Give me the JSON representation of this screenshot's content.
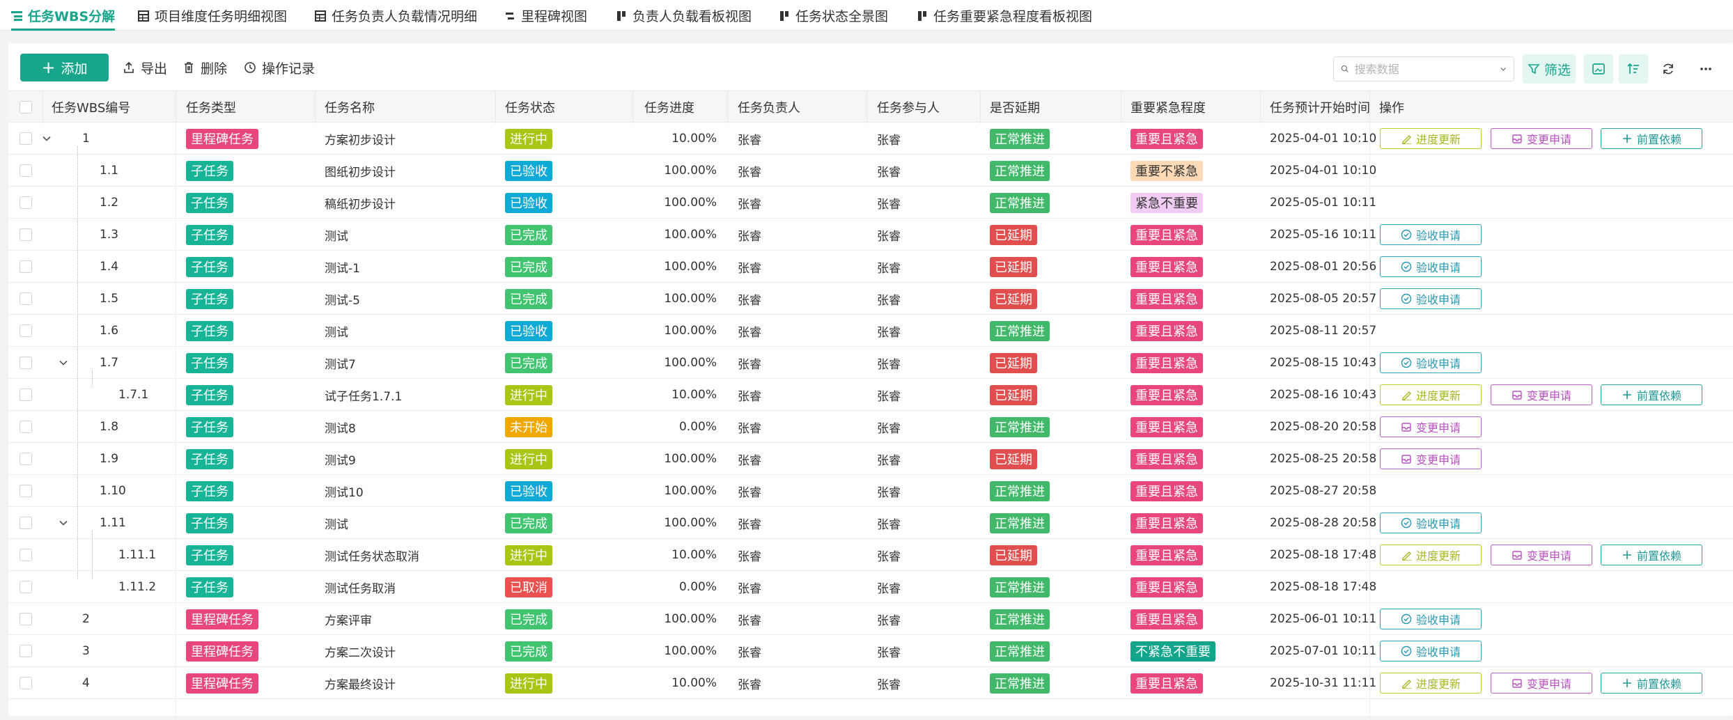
{
  "tabs": [
    {
      "label": "任务WBS分解",
      "icon": "list-icon",
      "active": true
    },
    {
      "label": "项目维度任务明细视图",
      "icon": "table-icon"
    },
    {
      "label": "任务负责人负载情况明细",
      "icon": "table-icon"
    },
    {
      "label": "里程碑视图",
      "icon": "milestone-icon"
    },
    {
      "label": "负责人负载看板视图",
      "icon": "kanban-icon"
    },
    {
      "label": "任务状态全景图",
      "icon": "kanban-icon"
    },
    {
      "label": "任务重要紧急程度看板视图",
      "icon": "kanban-icon"
    }
  ],
  "toolbar": {
    "add_label": "添加",
    "export_label": "导出",
    "delete_label": "删除",
    "history_label": "操作记录",
    "search_placeholder": "搜索数据",
    "filter_label": "筛选"
  },
  "columns": [
    "任务WBS编号",
    "任务类型",
    "任务名称",
    "任务状态",
    "任务进度",
    "任务负责人",
    "任务参与人",
    "是否延期",
    "重要紧急程度",
    "任务预计开始时间",
    "操作"
  ],
  "actions": {
    "progress": "进度更新",
    "change": "变更申请",
    "prereq": "前置依赖",
    "accept": "验收申请"
  },
  "colors": {
    "accent": "#17a58c",
    "milestone": "#e8467c",
    "subtask": "#17b497",
    "in_progress": "#a8c616",
    "accepted": "#11a9d6",
    "done": "#41c470",
    "not_started": "#f0a800",
    "cancelled": "#e9504f",
    "normal": "#41b86a",
    "delayed": "#e14e4e",
    "urgent_important": "#e8467c",
    "important_not_urgent": "#fdd9b5",
    "urgent_not_important": "#f1ccf4",
    "neither": "#12a58b"
  },
  "rows": [
    {
      "wbs": "1",
      "level": 0,
      "expanded": true,
      "type": "里程碑任务",
      "name": "方案初步设计",
      "status": "进行中",
      "progress": "10.00%",
      "owner": "张睿",
      "participant": "张睿",
      "delay": "正常推进",
      "priority": "重要且紧急",
      "start": "2025-04-01 10:10",
      "ops": [
        "progress",
        "change",
        "prereq"
      ]
    },
    {
      "wbs": "1.1",
      "level": 1,
      "type": "子任务",
      "name": "图纸初步设计",
      "status": "已验收",
      "progress": "100.00%",
      "owner": "张睿",
      "participant": "张睿",
      "delay": "正常推进",
      "priority": "重要不紧急",
      "start": "2025-04-01 10:10",
      "ops": []
    },
    {
      "wbs": "1.2",
      "level": 1,
      "type": "子任务",
      "name": "稿纸初步设计",
      "status": "已验收",
      "progress": "100.00%",
      "owner": "张睿",
      "participant": "张睿",
      "delay": "正常推进",
      "priority": "紧急不重要",
      "start": "2025-05-01 10:11",
      "ops": []
    },
    {
      "wbs": "1.3",
      "level": 1,
      "type": "子任务",
      "name": "测试",
      "status": "已完成",
      "progress": "100.00%",
      "owner": "张睿",
      "participant": "张睿",
      "delay": "已延期",
      "priority": "重要且紧急",
      "start": "2025-05-16 10:11",
      "ops": [
        "accept"
      ]
    },
    {
      "wbs": "1.4",
      "level": 1,
      "type": "子任务",
      "name": "测试-1",
      "status": "已完成",
      "progress": "100.00%",
      "owner": "张睿",
      "participant": "张睿",
      "delay": "已延期",
      "priority": "重要且紧急",
      "start": "2025-08-01 20:56",
      "ops": [
        "accept"
      ]
    },
    {
      "wbs": "1.5",
      "level": 1,
      "type": "子任务",
      "name": "测试-5",
      "status": "已完成",
      "progress": "100.00%",
      "owner": "张睿",
      "participant": "张睿",
      "delay": "已延期",
      "priority": "重要且紧急",
      "start": "2025-08-05 20:57",
      "ops": [
        "accept"
      ]
    },
    {
      "wbs": "1.6",
      "level": 1,
      "type": "子任务",
      "name": "测试",
      "status": "已验收",
      "progress": "100.00%",
      "owner": "张睿",
      "participant": "张睿",
      "delay": "正常推进",
      "priority": "重要且紧急",
      "start": "2025-08-11 20:57",
      "ops": []
    },
    {
      "wbs": "1.7",
      "level": 1,
      "expanded": true,
      "type": "子任务",
      "name": "测试7",
      "status": "已完成",
      "progress": "100.00%",
      "owner": "张睿",
      "participant": "张睿",
      "delay": "已延期",
      "priority": "重要且紧急",
      "start": "2025-08-15 10:43",
      "ops": [
        "accept"
      ]
    },
    {
      "wbs": "1.7.1",
      "level": 2,
      "type": "子任务",
      "name": "试子任务1.7.1",
      "status": "进行中",
      "progress": "10.00%",
      "owner": "张睿",
      "participant": "张睿",
      "delay": "已延期",
      "priority": "重要且紧急",
      "start": "2025-08-16 10:43",
      "ops": [
        "progress",
        "change",
        "prereq"
      ]
    },
    {
      "wbs": "1.8",
      "level": 1,
      "type": "子任务",
      "name": "测试8",
      "status": "未开始",
      "progress": "0.00%",
      "owner": "张睿",
      "participant": "张睿",
      "delay": "正常推进",
      "priority": "重要且紧急",
      "start": "2025-08-20 20:58",
      "ops": [
        "change"
      ]
    },
    {
      "wbs": "1.9",
      "level": 1,
      "type": "子任务",
      "name": "测试9",
      "status": "进行中",
      "progress": "100.00%",
      "owner": "张睿",
      "participant": "张睿",
      "delay": "已延期",
      "priority": "重要且紧急",
      "start": "2025-08-25 20:58",
      "ops": [
        "change"
      ]
    },
    {
      "wbs": "1.10",
      "level": 1,
      "type": "子任务",
      "name": "测试10",
      "status": "已验收",
      "progress": "100.00%",
      "owner": "张睿",
      "participant": "张睿",
      "delay": "正常推进",
      "priority": "重要且紧急",
      "start": "2025-08-27 20:58",
      "ops": []
    },
    {
      "wbs": "1.11",
      "level": 1,
      "expanded": true,
      "type": "子任务",
      "name": "测试",
      "status": "已完成",
      "progress": "100.00%",
      "owner": "张睿",
      "participant": "张睿",
      "delay": "正常推进",
      "priority": "重要且紧急",
      "start": "2025-08-28 20:58",
      "ops": [
        "accept"
      ]
    },
    {
      "wbs": "1.11.1",
      "level": 2,
      "type": "子任务",
      "name": "测试任务状态取消",
      "status": "进行中",
      "progress": "10.00%",
      "owner": "张睿",
      "participant": "张睿",
      "delay": "已延期",
      "priority": "重要且紧急",
      "start": "2025-08-18 17:48",
      "ops": [
        "progress",
        "change",
        "prereq"
      ]
    },
    {
      "wbs": "1.11.2",
      "level": 2,
      "type": "子任务",
      "name": "测试任务取消",
      "status": "已取消",
      "progress": "0.00%",
      "owner": "张睿",
      "participant": "张睿",
      "delay": "正常推进",
      "priority": "重要且紧急",
      "start": "2025-08-18 17:48",
      "ops": []
    },
    {
      "wbs": "2",
      "level": 0,
      "type": "里程碑任务",
      "name": "方案评审",
      "status": "已完成",
      "progress": "100.00%",
      "owner": "张睿",
      "participant": "张睿",
      "delay": "正常推进",
      "priority": "重要且紧急",
      "start": "2025-06-01 10:11",
      "ops": [
        "accept"
      ]
    },
    {
      "wbs": "3",
      "level": 0,
      "type": "里程碑任务",
      "name": "方案二次设计",
      "status": "已完成",
      "progress": "100.00%",
      "owner": "张睿",
      "participant": "张睿",
      "delay": "正常推进",
      "priority": "不紧急不重要",
      "start": "2025-07-01 10:11",
      "ops": [
        "accept"
      ]
    },
    {
      "wbs": "4",
      "level": 0,
      "type": "里程碑任务",
      "name": "方案最终设计",
      "status": "进行中",
      "progress": "10.00%",
      "owner": "张睿",
      "participant": "张睿",
      "delay": "正常推进",
      "priority": "重要且紧急",
      "start": "2025-10-31 11:11",
      "ops": [
        "progress",
        "change",
        "prereq"
      ]
    }
  ]
}
